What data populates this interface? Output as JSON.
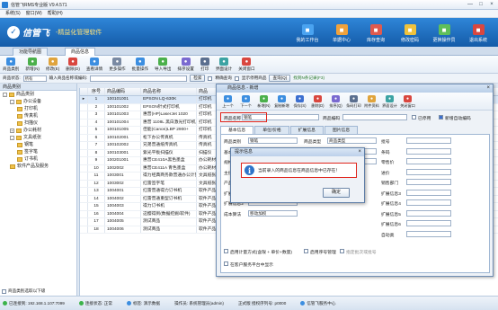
{
  "window": {
    "title": "信管飞RMS专业版 V9.4.571",
    "controls": [
      "—",
      "□",
      "×"
    ]
  },
  "menu": [
    "系统(S)",
    "窗口(W)",
    "帮助(H)"
  ],
  "banner": {
    "brand": "信管飞",
    "slogan": "-精益化管理软件",
    "nav": [
      {
        "label": "我的工作台",
        "icon": "desk-icon",
        "color": "#4aa3f0"
      },
      {
        "label": "单据中心",
        "icon": "document-icon",
        "color": "#f0a23c"
      },
      {
        "label": "库存查询",
        "icon": "warehouse-icon",
        "color": "#e05a4f"
      },
      {
        "label": "修改密码",
        "icon": "key-icon",
        "color": "#f0c23c"
      },
      {
        "label": "更换操作员",
        "icon": "user-switch-icon",
        "color": "#5fbf5a"
      },
      {
        "label": "退出系统",
        "icon": "exit-icon",
        "color": "#d9473f"
      }
    ]
  },
  "doc_tabs": [
    "功能导航图",
    "商品信息"
  ],
  "toolbar": [
    {
      "label": "商品类别",
      "icon": "category-icon",
      "color": "#3c8ee0"
    },
    {
      "label": "新增(N)",
      "icon": "add-icon",
      "color": "#4bb04b"
    },
    {
      "label": "修改(E)",
      "icon": "edit-icon",
      "color": "#e0a43c"
    },
    {
      "label": "删除(D)",
      "icon": "delete-icon",
      "color": "#d9473f"
    },
    {
      "label": "查看详情",
      "icon": "detail-icon",
      "color": "#3c8ee0"
    },
    {
      "label": "更多操作",
      "icon": "more-icon",
      "color": "#7a8aa3"
    },
    {
      "label": "批量操作",
      "icon": "batch-icon",
      "color": "#3c8ee0"
    },
    {
      "label": "导入导出",
      "icon": "import-export-icon",
      "color": "#4bb04b"
    },
    {
      "label": "排序设置",
      "icon": "sort-icon",
      "color": "#7a6ad0"
    },
    {
      "label": "打印",
      "icon": "print-icon",
      "color": "#5b6f8f"
    },
    {
      "label": "界面设计",
      "icon": "design-icon",
      "color": "#3ca3a3"
    },
    {
      "label": "关闭窗口",
      "icon": "close-icon",
      "color": "#d9473f"
    }
  ],
  "filter": {
    "status_label": "商品状态:",
    "status_value": "所有",
    "keyword_label": "输入商品名称或编码:",
    "keyword_value": "",
    "search_btn": "检索",
    "exact_label": "精确查询",
    "show_zero_label": "显示停用商品",
    "query_btn": "查询(Q)",
    "note": "找到N条记录(F3)"
  },
  "tree": {
    "header": "商品类别",
    "nodes": [
      {
        "label": "商品类别",
        "level": 0,
        "toggle": "-"
      },
      {
        "label": "办公设备",
        "level": 1,
        "toggle": "-"
      },
      {
        "label": "打印机",
        "level": 2,
        "toggle": ""
      },
      {
        "label": "传真机",
        "level": 2,
        "toggle": ""
      },
      {
        "label": "扫描仪",
        "level": 2,
        "toggle": ""
      },
      {
        "label": "办公耗材",
        "level": 1,
        "toggle": "+"
      },
      {
        "label": "文具纸张",
        "level": 1,
        "toggle": "-"
      },
      {
        "label": "钢笔",
        "level": 2,
        "toggle": ""
      },
      {
        "label": "签字笔",
        "level": 2,
        "toggle": ""
      },
      {
        "label": "订书机",
        "level": 2,
        "toggle": ""
      },
      {
        "label": "软件产品及服务",
        "level": 1,
        "toggle": ""
      }
    ],
    "footer": "商品类别选取以下级"
  },
  "grid": {
    "headers": [
      "序号",
      "商品编码",
      "商品名称",
      "商品"
    ],
    "rows": [
      [
        "1",
        "100101001",
        "EPSON LQ-630K",
        "打印机"
      ],
      [
        "2",
        "100101002",
        "EPSON针式打印机",
        "打印机"
      ],
      [
        "3",
        "100101003",
        "惠普(HP)LaserJet 1020",
        "打印机"
      ],
      [
        "4",
        "100101004",
        "惠普 1108L 黑白激光打印机",
        "打印机"
      ],
      [
        "5",
        "100101005",
        "佳能(Canon)LBP 2900+",
        "打印机"
      ],
      [
        "6",
        "100102001",
        "松下办公传真机",
        "传真机"
      ],
      [
        "7",
        "100102002",
        "兄弟普通纸传真机",
        "传真机"
      ],
      [
        "8",
        "100103001",
        "紫光平板扫描仪",
        "扫描仪"
      ],
      [
        "9",
        "100201001",
        "惠普CE410A黑色墨盒",
        "办公耗材"
      ],
      [
        "10",
        "1002002",
        "惠普CE411A 青色墨盒",
        "办公耗材"
      ],
      [
        "11",
        "1003001",
        "得力经典商务款普通办公计算器",
        "文具纸张"
      ],
      [
        "12",
        "1003002",
        "红雷签字笔",
        "文具纸张"
      ],
      [
        "13",
        "1004001",
        "红雷普通得力订书机",
        "软件产品"
      ],
      [
        "14",
        "1004002",
        "红雷普通重型订书机",
        "软件产品"
      ],
      [
        "15",
        "1004003",
        "得力订书机",
        "软件产品"
      ],
      [
        "16",
        "1004004",
        "这樱得到(数据挖掘/软件)",
        "软件产品"
      ],
      [
        "17",
        "1004005",
        "测试商品",
        "软件产品"
      ],
      [
        "18",
        "1004006",
        "测试商品",
        "软件产品"
      ]
    ],
    "right_header": "停用"
  },
  "dialog": {
    "title": "商品信息 - 新增",
    "tools": [
      {
        "label": "上一个",
        "icon": "prev-icon",
        "color": "#3c8ee0"
      },
      {
        "label": "下一个",
        "icon": "next-icon",
        "color": "#3c8ee0"
      },
      {
        "label": "新增(N)",
        "icon": "add-icon",
        "color": "#4bb04b"
      },
      {
        "label": "复制新增",
        "icon": "copy-icon",
        "color": "#3c8ee0"
      },
      {
        "label": "保存(S)",
        "icon": "save-icon",
        "color": "#3c6fd0"
      },
      {
        "label": "删除(D)",
        "icon": "delete-icon",
        "color": "#d9473f"
      },
      {
        "label": "排序(Q)",
        "icon": "sort-icon",
        "color": "#7a6ad0"
      },
      {
        "label": "条码打印",
        "icon": "barcode-icon",
        "color": "#5b6f8f"
      },
      {
        "label": "附件资料",
        "icon": "attach-icon",
        "color": "#e0a43c"
      },
      {
        "label": "界面设计",
        "icon": "design-icon",
        "color": "#3ca3a3"
      },
      {
        "label": "关闭窗口",
        "icon": "close-icon",
        "color": "#d9473f"
      }
    ],
    "name_label": "商品名称",
    "name_value": "钢笔",
    "code_label": "商品编码",
    "disabled_label": "已停用",
    "auto_code_label": "新增自动编码",
    "tabs": [
      "基本信息",
      "单位/价格",
      "扩展信息",
      "图片信息"
    ],
    "fields_left": [
      {
        "label": "商品类别",
        "value": "钢笔"
      },
      {
        "label": "基本单位",
        "value": "个"
      },
      {
        "label": "规格型号",
        "value": ""
      },
      {
        "label": "主供应商",
        "value": ""
      },
      {
        "label": "产品说明",
        "value": ""
      },
      {
        "label": "扩展信息1",
        "value": ""
      },
      {
        "label": "扩展信息2",
        "value": ""
      },
      {
        "label": "成本算法",
        "value": "移动加权"
      }
    ],
    "fields_right": [
      {
        "label": "商品类型",
        "value": "商品类型"
      },
      {
        "label": "辅助单位",
        "value": ""
      },
      {
        "label": "品牌",
        "value": ""
      }
    ],
    "fields_far": [
      {
        "label": "批号",
        "value": ""
      },
      {
        "label": "条码",
        "value": ""
      },
      {
        "label": "零售价",
        "value": ""
      },
      {
        "label": "进价",
        "value": ""
      },
      {
        "label": "销售部门",
        "value": ""
      },
      {
        "label": "扩展信息3",
        "value": ""
      },
      {
        "label": "扩展信息4",
        "value": ""
      },
      {
        "label": "扩展信息5",
        "value": ""
      },
      {
        "label": "扩展信息6",
        "value": ""
      },
      {
        "label": "自动类",
        "value": ""
      }
    ],
    "check1": "启用计量方式(含限 + 单价+数量)",
    "check2": "启用序号管理",
    "check3": "指定批次或批号",
    "check4": "在客户服务平台中显示"
  },
  "alert": {
    "title": "提示信息",
    "message": "当前录入的商品信息在商品信息中已存在！",
    "ok": "确定"
  },
  "status": [
    {
      "label": "已连接到: 192.168.1.107:7099",
      "color": "#3cb34a"
    },
    {
      "label": "连接状态: 正常",
      "color": "#3cb34a"
    },
    {
      "label": "标签: 演示数据",
      "color": "#3c8ee0"
    },
    {
      "label": "操作员: 系统管理员(admin)",
      "color": ""
    },
    {
      "label": "正式版 授权序列号: p0000",
      "color": ""
    },
    {
      "label": "信管飞服务中心",
      "color": "#3c8ee0"
    }
  ]
}
